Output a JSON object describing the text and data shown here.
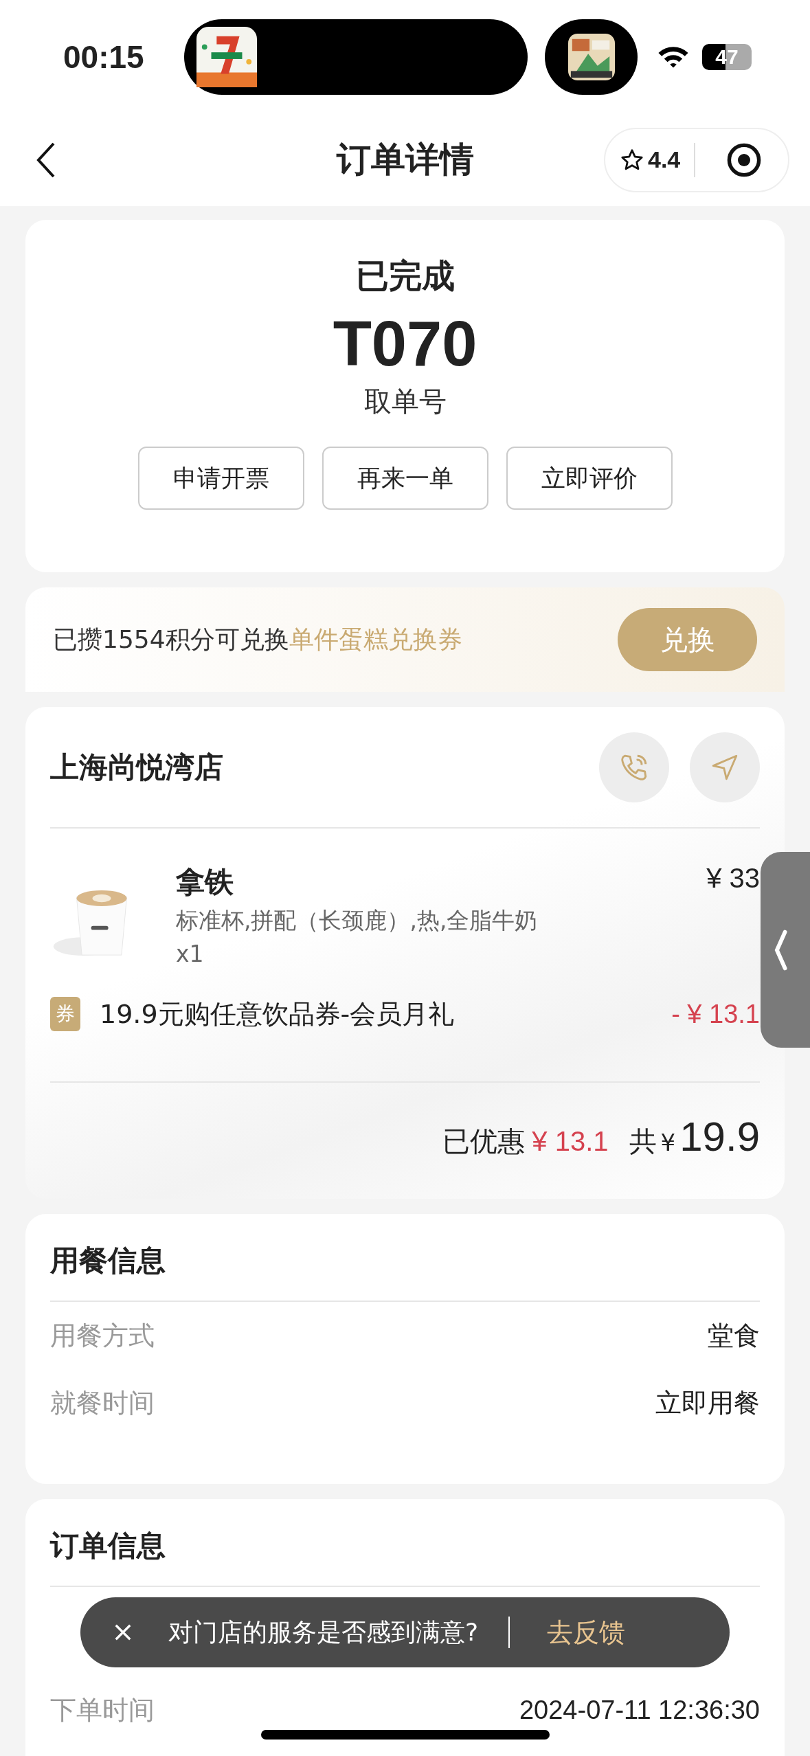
{
  "status_bar": {
    "time": "00:15",
    "battery": "47"
  },
  "nav": {
    "title": "订单详情",
    "rating": "4.4"
  },
  "order_status": {
    "status": "已完成",
    "pickup_code": "T070",
    "pickup_label": "取单号",
    "actions": [
      "申请开票",
      "再来一单",
      "立即评价"
    ]
  },
  "points": {
    "text": "已攒1554积分可兑换",
    "highlight": "单件蛋糕兑换券",
    "button": "兑换"
  },
  "store": {
    "name": "上海尚悦湾店",
    "items": [
      {
        "name": "拿铁",
        "specs": "标准杯,拼配（长颈鹿）,热,全脂牛奶",
        "quantity": "x1",
        "price": "¥ 33"
      }
    ],
    "coupon": {
      "badge": "券",
      "name": "19.9元购任意饮品券-会员月礼",
      "amount": "- ¥ 13.1"
    },
    "discount_label": "已优惠",
    "discount": "¥ 13.1",
    "total_label": "共",
    "currency": "¥",
    "total": "19.9"
  },
  "dining_info": {
    "title": "用餐信息",
    "rows": [
      {
        "label": "用餐方式",
        "value": "堂食"
      },
      {
        "label": "就餐时间",
        "value": "立即用餐"
      }
    ]
  },
  "order_info": {
    "title": "订单信息",
    "rows": [
      {
        "label": "下单时间",
        "value": "2024-07-11 12:36:30"
      }
    ]
  },
  "toast": {
    "message": "对门店的服务是否感到满意?",
    "action": "去反馈"
  }
}
